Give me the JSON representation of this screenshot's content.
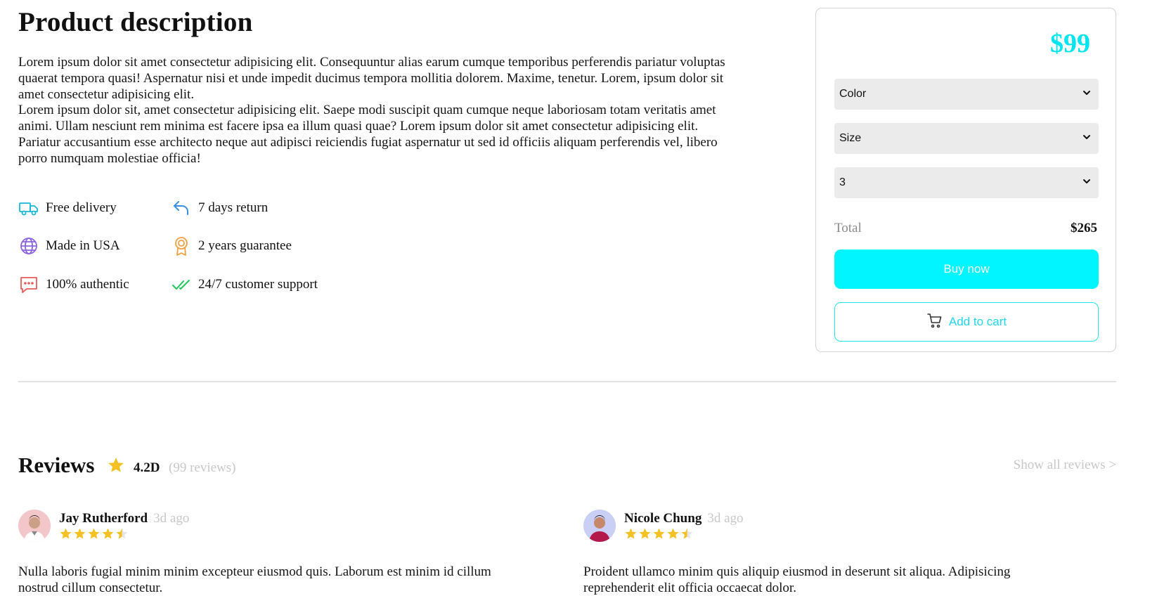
{
  "product": {
    "title": "Product description",
    "paragraph1": "Lorem ipsum dolor sit amet consectetur adipisicing elit. Consequuntur alias earum cumque temporibus perferendis pariatur voluptas quaerat tempora quasi! Aspernatur nisi et unde impedit ducimus tempora mollitia dolorem. Maxime, tenetur. Lorem, ipsum dolor sit amet consectetur adipisicing elit.",
    "paragraph2": "Lorem ipsum dolor sit, amet consectetur adipisicing elit. Saepe modi suscipit quam cumque neque laboriosam totam veritatis amet animi. Ullam nesciunt rem minima est facere ipsa ea illum quasi quae? Lorem ipsum dolor sit amet consectetur adipisicing elit. Pariatur accusantium esse architecto neque aut adipisci reiciendis fugiat aspernatur ut sed id officiis aliquam perferendis vel, libero porro numquam molestiae officia!"
  },
  "features": [
    {
      "label": "Free delivery",
      "icon": "truck-icon",
      "color": "#19b7d8"
    },
    {
      "label": "7 days return",
      "icon": "return-arrow-icon",
      "color": "#3b8fe0"
    },
    {
      "label": "Made in USA",
      "icon": "globe-icon",
      "color": "#8a63e0"
    },
    {
      "label": "2 years guarantee",
      "icon": "award-icon",
      "color": "#f0a040"
    },
    {
      "label": "100% authentic",
      "icon": "message-dots-icon",
      "color": "#e85c5c"
    },
    {
      "label": "24/7 customer support",
      "icon": "double-check-icon",
      "color": "#22c55e"
    }
  ],
  "purchase": {
    "price": "$99",
    "selects": {
      "color": "Color",
      "size": "Size",
      "quantity": "3"
    },
    "total_label": "Total",
    "total_value": "$265",
    "buy_label": "Buy now",
    "cart_label": "Add to cart",
    "accent": "#00f5ff"
  },
  "reviews": {
    "title": "Reviews",
    "rating": "4.2D",
    "count": "(99 reviews)",
    "show_all": "Show all reviews >",
    "items": [
      {
        "name": "Jay Rutherford",
        "time": "3d ago",
        "rating": 4.5,
        "text": "Nulla laboris fugial minim minim excepteur eiusmod quis. Laborum est minim id cillum nostrud cillum consectetur."
      },
      {
        "name": "Nicole Chung",
        "time": "3d ago",
        "rating": 4.5,
        "text": "Proident ullamco minim quis aliquip eiusmod in deserunt sit aliqua. Adipisicing reprehenderit elit officia occaecat dolor."
      }
    ]
  }
}
